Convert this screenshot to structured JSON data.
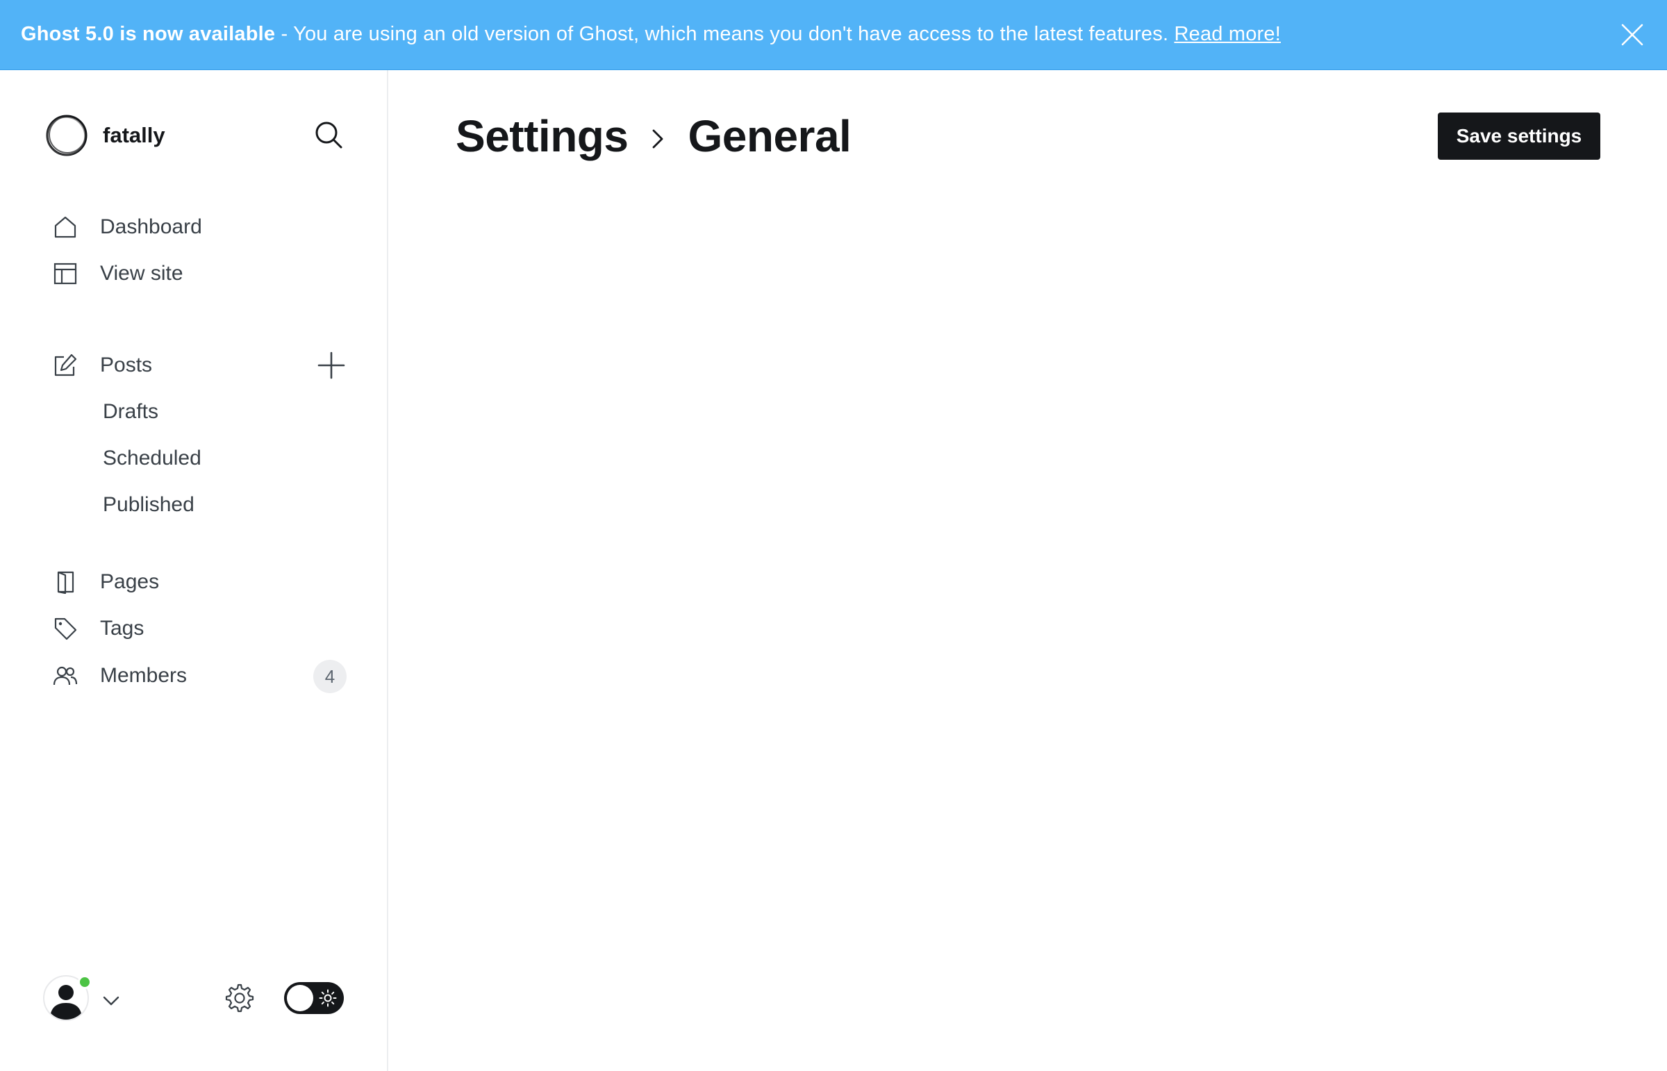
{
  "banner": {
    "title": "Ghost 5.0 is now available",
    "separator": " - ",
    "message": "You are using an old version of Ghost, which means you don't have access to the latest features.",
    "link": "Read more!",
    "close_icon": "close-icon"
  },
  "sidebar": {
    "site_name": "fatally",
    "logo_icon": "site-logo-ring",
    "search_icon": "search-icon",
    "items": [
      {
        "label": "Dashboard",
        "icon": "home-icon"
      },
      {
        "label": "View site",
        "icon": "layout-icon"
      },
      {
        "label": "Posts",
        "icon": "edit-icon"
      },
      {
        "label": "Pages",
        "icon": "page-icon"
      },
      {
        "label": "Tags",
        "icon": "tag-icon"
      },
      {
        "label": "Members",
        "icon": "members-icon",
        "count": "4"
      }
    ],
    "post_subitems": [
      "Drafts",
      "Scheduled",
      "Published"
    ],
    "new_post_icon": "plus-icon",
    "footer": {
      "avatar_icon": "user-avatar-icon",
      "status": "online",
      "status_color": "#4cc344",
      "menu_icon": "chevron-down-icon",
      "settings_icon": "gear-icon",
      "theme_toggle": "dark-mode-toggle"
    }
  },
  "main": {
    "breadcrumb_parent": "Settings",
    "breadcrumb_current": "General",
    "save_label": "Save settings"
  },
  "colors": {
    "banner_bg": "#52b3f7",
    "primary_button": "#15171a",
    "text": "#15171a",
    "nav_text": "#394047"
  }
}
